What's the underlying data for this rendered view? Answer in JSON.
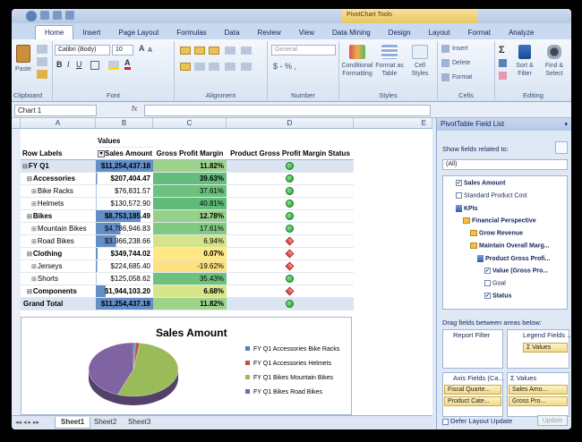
{
  "ribbon": {
    "tabs": [
      "Home",
      "Insert",
      "Page Layout",
      "Formulas",
      "Data",
      "Review",
      "View",
      "Data Mining",
      "Design",
      "Layout",
      "Format",
      "Analyze"
    ],
    "context_title": "PivotChart Tools",
    "groups": [
      "Clipboard",
      "Font",
      "Alignment",
      "Number",
      "Styles",
      "Cells",
      "Editing"
    ],
    "clipboard_paste": "Paste",
    "font_name": "Calibri (Body)",
    "font_size": "10",
    "number_format": "General",
    "number_symbols": "$ - % ,",
    "styles_buttons": [
      "Conditional Formatting",
      "Format as Table",
      "Cell Styles"
    ],
    "cells_buttons": [
      "Insert",
      "Delete",
      "Format"
    ],
    "editing_buttons": [
      "Sort & Filter",
      "Find & Select"
    ]
  },
  "formula_bar": {
    "name_box": "Chart 1",
    "fx": "fx",
    "content": ""
  },
  "columns": [
    "A",
    "B",
    "C",
    "D",
    "E"
  ],
  "table": {
    "values_label": "Values",
    "headers": [
      "Row Labels",
      "Sales Amount",
      "Gross Profit Margin",
      "Product Gross Profit Margin Status"
    ],
    "rows": [
      {
        "label": "FY Q1",
        "sales": "$11,254,437.18",
        "gpm": "11.82%",
        "level": 0
      },
      {
        "label": "Accessories",
        "sales": "$207,404.47",
        "gpm": "39.63%",
        "level": 1
      },
      {
        "label": "Bike Racks",
        "sales": "$76,831.57",
        "gpm": "37.61%",
        "level": 2
      },
      {
        "label": "Helmets",
        "sales": "$130,572.90",
        "gpm": "40.81%",
        "level": 2
      },
      {
        "label": "Bikes",
        "sales": "$8,753,185.49",
        "gpm": "12.78%",
        "level": 1
      },
      {
        "label": "Mountain Bikes",
        "sales": "$4,786,946.83",
        "gpm": "17.61%",
        "level": 2
      },
      {
        "label": "Road Bikes",
        "sales": "$3,966,238.66",
        "gpm": "6.94%",
        "level": 2
      },
      {
        "label": "Clothing",
        "sales": "$349,744.02",
        "gpm": "0.07%",
        "level": 1
      },
      {
        "label": "Jerseys",
        "sales": "$224,685.40",
        "gpm": "-19.62%",
        "level": 2
      },
      {
        "label": "Shorts",
        "sales": "$125,058.62",
        "gpm": "35.43%",
        "level": 2
      },
      {
        "label": "Components",
        "sales": "$1,944,103.20",
        "gpm": "6.68%",
        "level": 1
      },
      {
        "label": "Grand Total",
        "sales": "$11,254,437.18",
        "gpm": "11.82%",
        "level": 0
      }
    ],
    "status": [
      "good",
      "good",
      "good",
      "good",
      "good",
      "good",
      "bad",
      "bad",
      "bad",
      "good",
      "bad",
      "good"
    ],
    "gpm_colors": [
      "#9dd38a",
      "#63be7b",
      "#6cc17c",
      "#5fbb79",
      "#96d089",
      "#80c983",
      "#d5e48a",
      "#fde883",
      "#fbe180",
      "#6cc17c",
      "#d8e58a",
      "#9dd38a"
    ],
    "sales_fill": [
      1,
      0.02,
      0.01,
      0.01,
      0.78,
      0.43,
      0.35,
      0.03,
      0.02,
      0.01,
      0.17,
      1
    ]
  },
  "chart_data": {
    "type": "pie",
    "title": "Sales Amount",
    "categories": [
      "FY Q1 Accessories Bike Racks",
      "FY Q1 Accessories Helmets",
      "FY Q1 Bikes Mountain Bikes",
      "FY Q1 Bikes Road Bikes"
    ],
    "values": [
      76831.57,
      130572.9,
      4786946.83,
      3966238.66
    ],
    "colors": [
      "#4f81bd",
      "#c0504d",
      "#9bbb59",
      "#8064a2"
    ],
    "legend": "right"
  },
  "sheet_tabs": [
    "Sheet1",
    "Sheet2",
    "Sheet3"
  ],
  "field_list": {
    "title": "PivotTable Field List",
    "show_fields_label": "Show fields related to:",
    "show_fields_value": "(All)",
    "fields": [
      {
        "label": "Sales Amount",
        "checked": true,
        "bold": true,
        "indent": 0
      },
      {
        "label": "Standard Product Cost",
        "checked": false,
        "bold": false,
        "indent": 0
      },
      {
        "label": "KPIs",
        "checked": null,
        "bold": true,
        "indent": 0,
        "type": "kpi"
      },
      {
        "label": "Financial Perspective",
        "checked": null,
        "bold": true,
        "indent": 1,
        "type": "folder"
      },
      {
        "label": "Grow Revenue",
        "checked": null,
        "bold": true,
        "indent": 2,
        "type": "folder"
      },
      {
        "label": "Maintain Overall Marg...",
        "checked": null,
        "bold": true,
        "indent": 2,
        "type": "folder"
      },
      {
        "label": "Product Gross Profi...",
        "checked": null,
        "bold": true,
        "indent": 3,
        "type": "kpi"
      },
      {
        "label": "Value (Gross Pro...",
        "checked": true,
        "bold": true,
        "indent": 4
      },
      {
        "label": "Goal",
        "checked": false,
        "bold": false,
        "indent": 4
      },
      {
        "label": "Status",
        "checked": true,
        "bold": true,
        "indent": 4
      }
    ],
    "drag_label": "Drag fields between areas below:",
    "report_filter": "Report Filter",
    "legend_fields": "Legend Fields ...",
    "legend_chip": "Values",
    "axis_fields": "Axis Fields (Ca...",
    "values_area": "Values",
    "axis_chips": [
      "Fiscal Quarte...",
      "Product Cate..."
    ],
    "value_chips": [
      "Sales Amo...",
      "Gross Pro..."
    ],
    "defer_label": "Defer Layout Update",
    "update_button": "Update"
  }
}
